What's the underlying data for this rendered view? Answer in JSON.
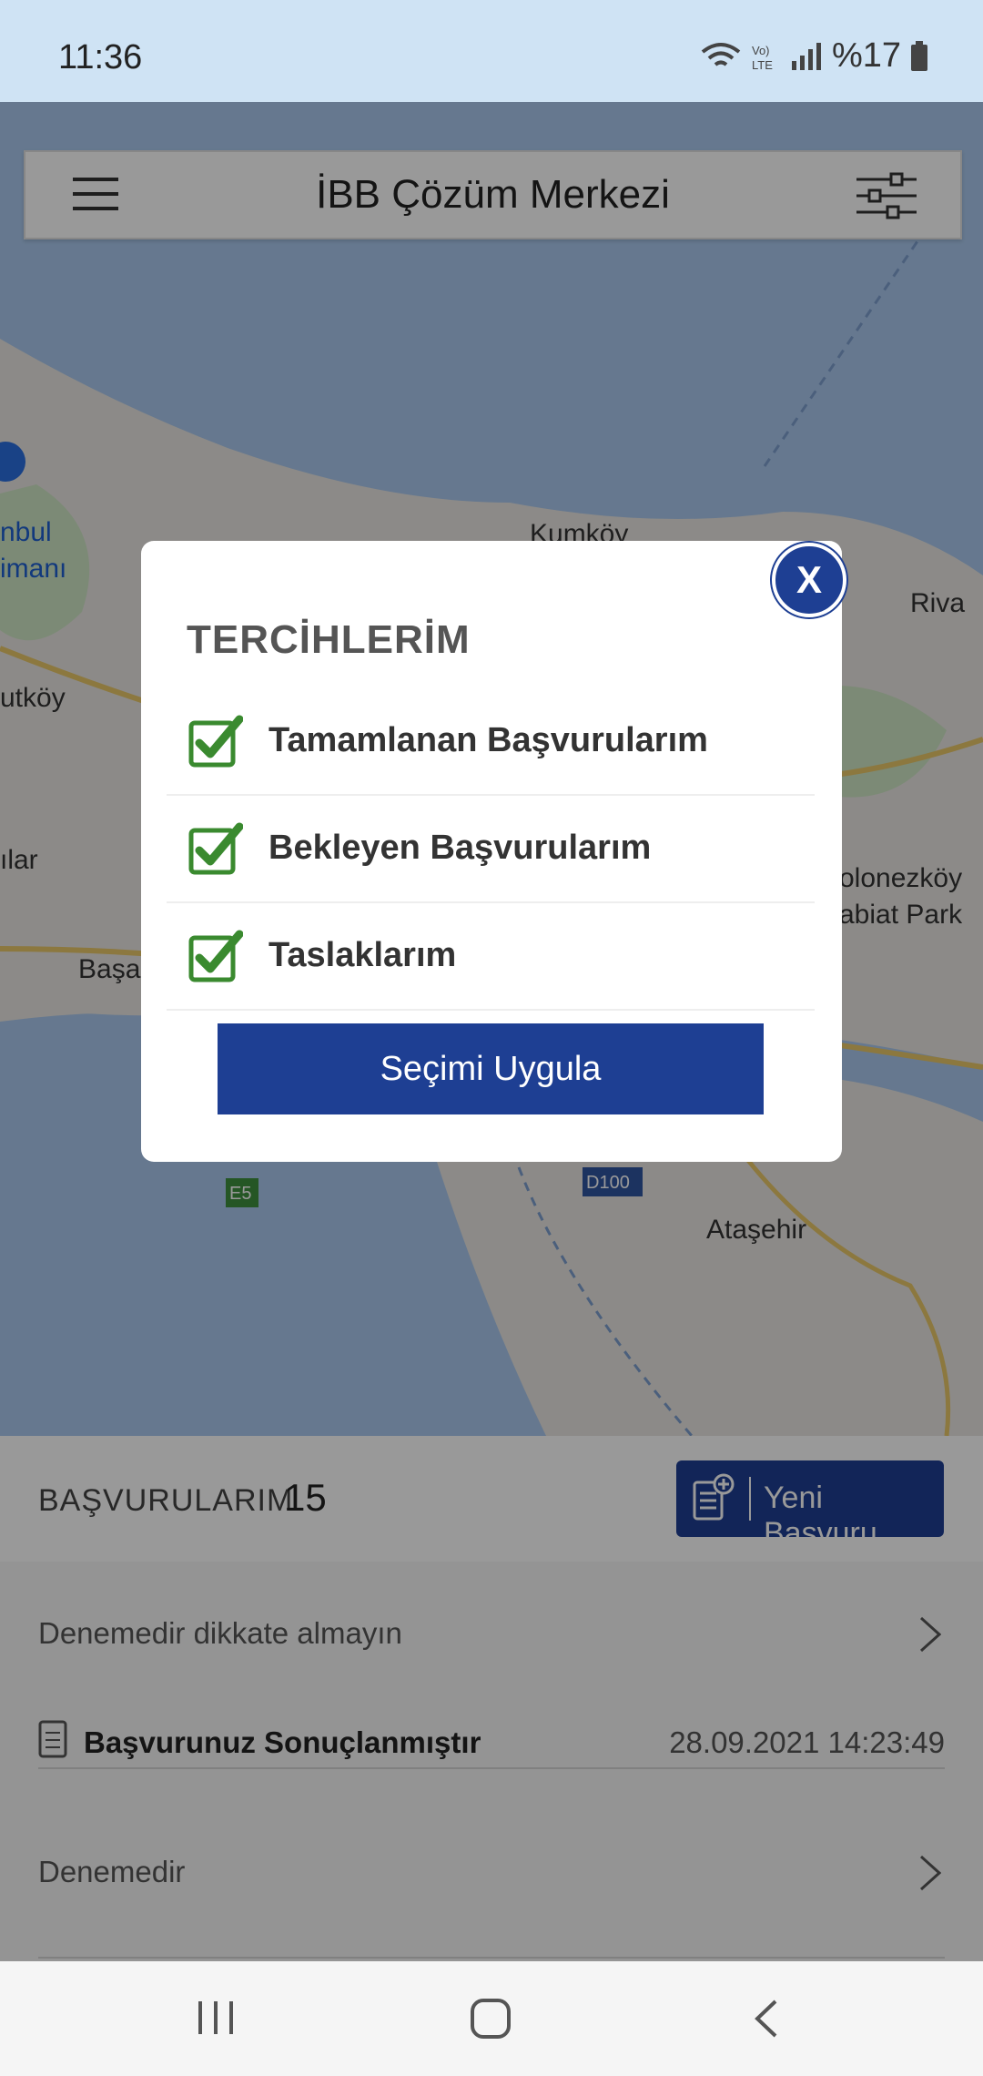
{
  "status_bar": {
    "time": "11:36",
    "battery": "%17"
  },
  "header": {
    "title": "İBB Çözüm Merkezi"
  },
  "map": {
    "labels": [
      "Kumköy",
      "Riva",
      "nbul",
      "imanı",
      "utköy",
      "ılar",
      "Başa",
      "olonezköy",
      "abiat Park",
      "Ataşehir",
      "E5",
      "D100"
    ]
  },
  "applications": {
    "title": "BAŞVURULARIM",
    "count": "15",
    "new_button_label": "Yeni Başvuru",
    "items": [
      {
        "title": "Denemedir dikkate almayın"
      },
      {
        "status": "Başvurunuz Sonuçlanmıştır",
        "date": "28.09.2021 14:23:49"
      },
      {
        "title": "Denemedir"
      }
    ]
  },
  "modal": {
    "title": "TERCİHLERİM",
    "options": [
      {
        "label": "Tamamlanan Başvurularım",
        "checked": true
      },
      {
        "label": "Bekleyen Başvurularım",
        "checked": true
      },
      {
        "label": "Taslaklarım",
        "checked": true
      }
    ],
    "apply_label": "Seçimi Uygula",
    "close_label": "X"
  },
  "colors": {
    "accent": "#1e3f93",
    "check": "#3a8a2f"
  }
}
